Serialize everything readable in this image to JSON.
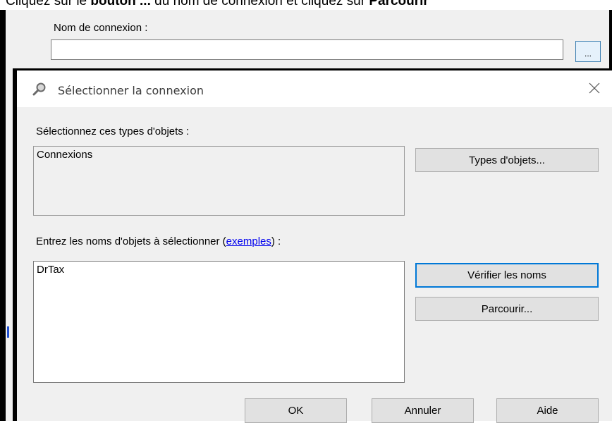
{
  "caption": {
    "prefix": "Cliquez sur le ",
    "bold1": "bouton ...",
    "middle": " du nom de connexion et cliquez sur ",
    "bold2": "Parcourir"
  },
  "background": {
    "login_label": "Nom de connexion :",
    "browse_dots_label": "..."
  },
  "dialog": {
    "title": "Sélectionner la connexion",
    "object_types_label": "Sélectionnez ces types d'objets :",
    "object_types_value": "Connexions",
    "object_types_button": "Types d'objets...",
    "names_label_prefix": "Entrez les noms d'objets à sélectionner (",
    "examples_link": "exemples",
    "names_label_suffix": ") :",
    "names_value": "DrTax",
    "check_names_button": "Vérifier les noms",
    "browse_button": "Parcourir...",
    "ok_button": "OK",
    "cancel_button": "Annuler",
    "help_button": "Aide"
  },
  "colors": {
    "accent": "#0078d7",
    "link": "#0000ee",
    "dialog_bg": "#f0f0f0"
  },
  "icons": {
    "title_icon": "magnifier-icon",
    "close_icon": "close-icon"
  }
}
